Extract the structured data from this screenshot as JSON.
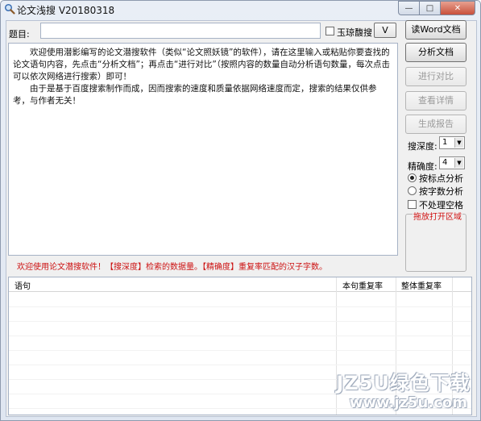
{
  "window": {
    "title": "论文浅搜 V20180318",
    "minimize_glyph": "—",
    "maximize_glyph": "□",
    "close_glyph": "✕"
  },
  "topic": {
    "label": "题目:",
    "value": "",
    "checkbox_label": "玉琼馥搜",
    "checkbox_checked": false,
    "dropdown_glyph": "V"
  },
  "main_text": {
    "paragraphs": [
      "欢迎使用潜影编写的论文潜搜软件（类似“论文照妖镜”的软件），请在这里输入或粘贴你要查找的论文语句内容，先点击“分析文档”；再点击“进行对比”（按照内容的数量自动分析语句数量，每次点击可以依次网络进行搜索）即可！",
      "由于是基于百度搜索制作而成，因而搜索的速度和质量依据网络速度而定，搜索的结果仅供参考，与作者无关！"
    ]
  },
  "sidebar": {
    "read_word": "读Word文档",
    "analyze": "分析文档",
    "compare": "进行对比",
    "details": "查看详情",
    "report": "生成报告",
    "search_depth_label": "搜深度:",
    "search_depth_value": "1",
    "precision_label": "精确度:",
    "precision_value": "4",
    "radio_punct": "按标点分析",
    "radio_chars": "按字数分析",
    "radio_selected": "punct",
    "checkbox_spaces": "不处理空格",
    "checkbox_spaces_checked": false,
    "dropzone_label": "拖放打开区域"
  },
  "status": {
    "text": "欢迎使用论文潜搜软件！【搜深度】检索的数据量。【精确度】重复率匹配的汉子字数。"
  },
  "table": {
    "columns": [
      "语句",
      "本句重复率",
      "整体重复率"
    ],
    "rows": []
  },
  "watermark": {
    "top": "JZ5U绿色下载",
    "bottom": "www.jz5u.com"
  },
  "colors": {
    "accent_red": "#cc1111",
    "window_frame": "#8e9aae"
  }
}
